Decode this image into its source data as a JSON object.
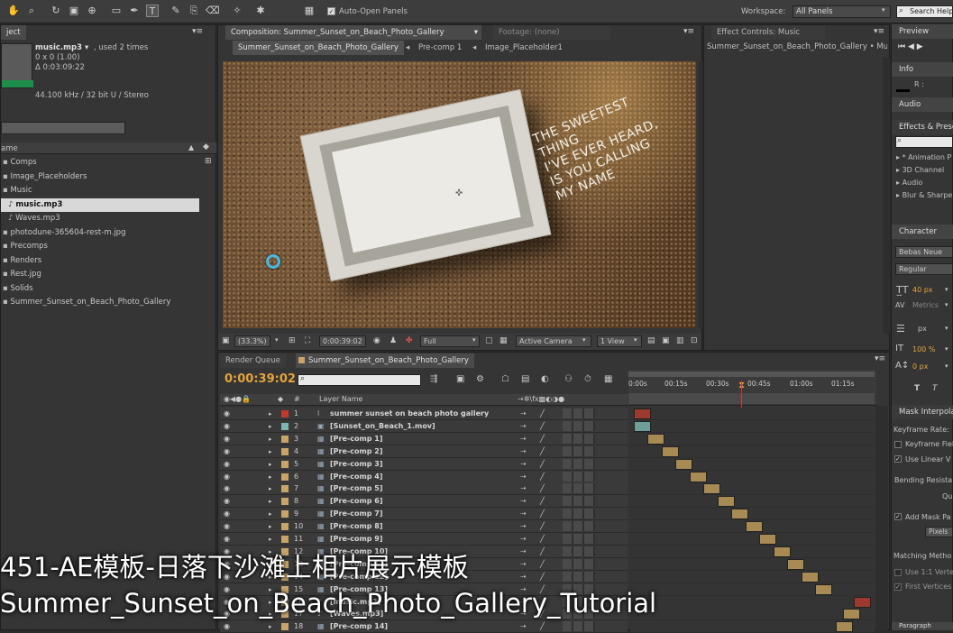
{
  "toolbar": {
    "auto_open_label": "Auto-Open Panels",
    "workspace_label": "Workspace:",
    "workspace_value": "All Panels",
    "search_placeholder": "Search Help"
  },
  "project": {
    "tab_label": "ject",
    "file_name": "music.mp3 ▾",
    "used_text": ", used 2 times",
    "dims": "0 x 0 (1.00)",
    "duration": "Δ 0:03:09:22",
    "audio_info": "44.100 kHz / 32 bit U / Stereo",
    "col_name": "ame",
    "items": [
      {
        "label": "Comps",
        "indent": 0,
        "selected": false
      },
      {
        "label": "Image_Placeholders",
        "indent": 0,
        "selected": false
      },
      {
        "label": "Music",
        "indent": 0,
        "selected": false
      },
      {
        "label": "music.mp3",
        "indent": 1,
        "selected": true
      },
      {
        "label": "Waves.mp3",
        "indent": 1,
        "selected": false
      },
      {
        "label": "photodune-365604-rest-m.jpg",
        "indent": 0,
        "selected": false
      },
      {
        "label": "Precomps",
        "indent": 0,
        "selected": false
      },
      {
        "label": "Renders",
        "indent": 0,
        "selected": false
      },
      {
        "label": "Rest.jpg",
        "indent": 0,
        "selected": false
      },
      {
        "label": "Solids",
        "indent": 0,
        "selected": false
      },
      {
        "label": "Summer_Sunset_on_Beach_Photo_Gallery",
        "indent": 0,
        "selected": false
      }
    ]
  },
  "composition": {
    "tab_label": "Composition: Summer_Sunset_on_Beach_Photo_Gallery",
    "footage_tab": "Footage: (none)",
    "breadcrumbs": [
      "Summer_Sunset_on_Beach_Photo_Gallery",
      "Pre-comp 1",
      "Image_Placeholder1"
    ],
    "viewer_text": [
      "THE SWEETEST THING",
      "I'VE EVER HEARD,",
      "IS YOU CALLING",
      "MY NAME"
    ],
    "zoom": "(33.3%)",
    "timecode": "0:00:39:02",
    "resolution": "Full",
    "camera": "Active Camera",
    "view": "1 View"
  },
  "effect_controls": {
    "tab_label": "Effect Controls: Music",
    "breadcrumb": "Summer_Sunset_on_Beach_Photo_Gallery • Music"
  },
  "timeline": {
    "render_queue_tab": "Render Queue",
    "comp_tab": "Summer_Sunset_on_Beach_Photo_Gallery",
    "current_time": "0:00:39:02",
    "col_layer_name": "Layer Name",
    "col_num": "#",
    "ruler_labels": [
      "0:00s",
      "00:15s",
      "00:30s",
      "00:45s",
      "01:00s",
      "01:15s"
    ],
    "layers": [
      {
        "num": "1",
        "name": "summer sunset on beach photo gallery",
        "color": "#c0392b",
        "type": "T"
      },
      {
        "num": "2",
        "name": "[Sunset_on_Beach_1.mov]",
        "color": "#7fb7b0",
        "type": "M"
      },
      {
        "num": "3",
        "name": "[Pre-comp 1]",
        "color": "#c8a46a",
        "type": "C"
      },
      {
        "num": "4",
        "name": "[Pre-comp 2]",
        "color": "#c8a46a",
        "type": "C"
      },
      {
        "num": "5",
        "name": "[Pre-comp 3]",
        "color": "#c8a46a",
        "type": "C"
      },
      {
        "num": "6",
        "name": "[Pre-comp 4]",
        "color": "#c8a46a",
        "type": "C"
      },
      {
        "num": "7",
        "name": "[Pre-comp 5]",
        "color": "#c8a46a",
        "type": "C"
      },
      {
        "num": "8",
        "name": "[Pre-comp 6]",
        "color": "#c8a46a",
        "type": "C"
      },
      {
        "num": "9",
        "name": "[Pre-comp 7]",
        "color": "#c8a46a",
        "type": "C"
      },
      {
        "num": "10",
        "name": "[Pre-comp 8]",
        "color": "#c8a46a",
        "type": "C"
      },
      {
        "num": "11",
        "name": "[Pre-comp 9]",
        "color": "#c8a46a",
        "type": "C"
      },
      {
        "num": "12",
        "name": "[Pre-comp 10]",
        "color": "#c8a46a",
        "type": "C"
      },
      {
        "num": "13",
        "name": "[Pre-comp 11]",
        "color": "#c8a46a",
        "type": "C"
      },
      {
        "num": "14",
        "name": "[Pre-comp 12]",
        "color": "#c8a46a",
        "type": "C"
      },
      {
        "num": "15",
        "name": "[Pre-comp 13]",
        "color": "#c8a46a",
        "type": "C"
      },
      {
        "num": "16",
        "name": "[music.mp3]",
        "color": "#c8a46a",
        "type": "A"
      },
      {
        "num": "17",
        "name": "[Waves.mp3]",
        "color": "#c8a46a",
        "type": "A"
      },
      {
        "num": "18",
        "name": "[Pre-comp 14]",
        "color": "#c8a46a",
        "type": "C"
      }
    ]
  },
  "right_panels": {
    "preview": "Preview",
    "info": "Info",
    "info_r": "R :",
    "audio": "Audio",
    "effects": "Effects & Prese",
    "effects_items": [
      "* Animation P",
      "3D Channel",
      "Audio",
      "Blur & Sharpe"
    ],
    "character": "Character",
    "font": "Bebas Neue",
    "style": "Regular",
    "font_size": "40 px",
    "kerning": "Metrics",
    "leading_unit": "px",
    "vscale": "100 %",
    "baseline": "0 px",
    "mask_interp": "Mask Interpola",
    "keyframe_rate": "Keyframe Rate:",
    "keyframe_fields": "Keyframe Fiel",
    "use_linear": "Use Linear V",
    "bending": "Bending Resista",
    "quality": "Qu",
    "add_mask": "Add Mask Pa",
    "pixels": "Pixels",
    "matching": "Matching Metho",
    "use_11": "Use 1:1 Verte",
    "first_vertices": "First Vertices",
    "paragraph": "Paragraph"
  },
  "captions": {
    "line1": "451-AE模板-日落下沙滩上相片展示模板",
    "line2": "Summer_Sunset_on_Beach_Photo_Gallery_Tutorial"
  }
}
